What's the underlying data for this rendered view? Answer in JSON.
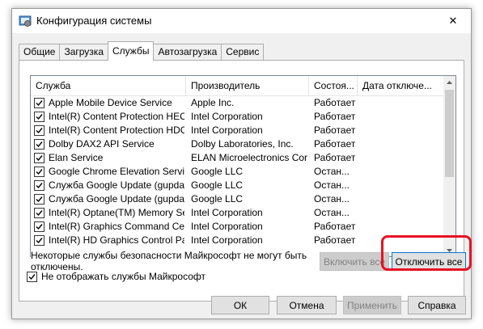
{
  "window": {
    "title": "Конфигурация системы",
    "close_glyph": "✕"
  },
  "tabs": [
    {
      "label": "Общие",
      "active": false
    },
    {
      "label": "Загрузка",
      "active": false
    },
    {
      "label": "Службы",
      "active": true
    },
    {
      "label": "Автозагрузка",
      "active": false
    },
    {
      "label": "Сервис",
      "active": false
    }
  ],
  "services": {
    "columns": [
      "Служба",
      "Производитель",
      "Состоя...",
      "Дата отключе..."
    ],
    "rows": [
      {
        "checked": true,
        "name": "Apple Mobile Device Service",
        "vendor": "Apple Inc.",
        "status": "Работает",
        "date": ""
      },
      {
        "checked": true,
        "name": "Intel(R) Content Protection HEC...",
        "vendor": "Intel Corporation",
        "status": "Работает",
        "date": ""
      },
      {
        "checked": true,
        "name": "Intel(R) Content Protection HDC...",
        "vendor": "Intel Corporation",
        "status": "Работает",
        "date": ""
      },
      {
        "checked": true,
        "name": "Dolby DAX2 API Service",
        "vendor": "Dolby Laboratories, Inc.",
        "status": "Работает",
        "date": ""
      },
      {
        "checked": true,
        "name": "Elan Service",
        "vendor": "ELAN Microelectronics Corp.",
        "status": "Работает",
        "date": ""
      },
      {
        "checked": true,
        "name": "Google Chrome Elevation Servic...",
        "vendor": "Google LLC",
        "status": "Остан...",
        "date": ""
      },
      {
        "checked": true,
        "name": "Служба Google Update (gupdate)",
        "vendor": "Google LLC",
        "status": "Остан...",
        "date": ""
      },
      {
        "checked": true,
        "name": "Служба Google Update (gupdatem)",
        "vendor": "Google LLC",
        "status": "Остан...",
        "date": ""
      },
      {
        "checked": true,
        "name": "Intel(R) Optane(TM) Memory Se...",
        "vendor": "Intel Corporation",
        "status": "Остан...",
        "date": ""
      },
      {
        "checked": true,
        "name": "Intel(R) Graphics Command Cen...",
        "vendor": "Intel Corporation",
        "status": "Работает",
        "date": ""
      },
      {
        "checked": true,
        "name": "Intel(R) HD Graphics Control Pa...",
        "vendor": "Intel Corporation",
        "status": "Работает",
        "date": ""
      }
    ]
  },
  "note": "Некоторые службы безопасности Майкрософт не могут быть отключены.",
  "buttons": {
    "enable_all": "Включить все",
    "disable_all": "Отключить все",
    "ok": "ОК",
    "cancel": "Отмена",
    "apply": "Применить",
    "help": "Справка"
  },
  "hide_ms": {
    "label": "Не отображать службы Майкрософт",
    "checked": true
  },
  "colors": {
    "highlight": "#e81123",
    "focus": "#0078d7"
  }
}
